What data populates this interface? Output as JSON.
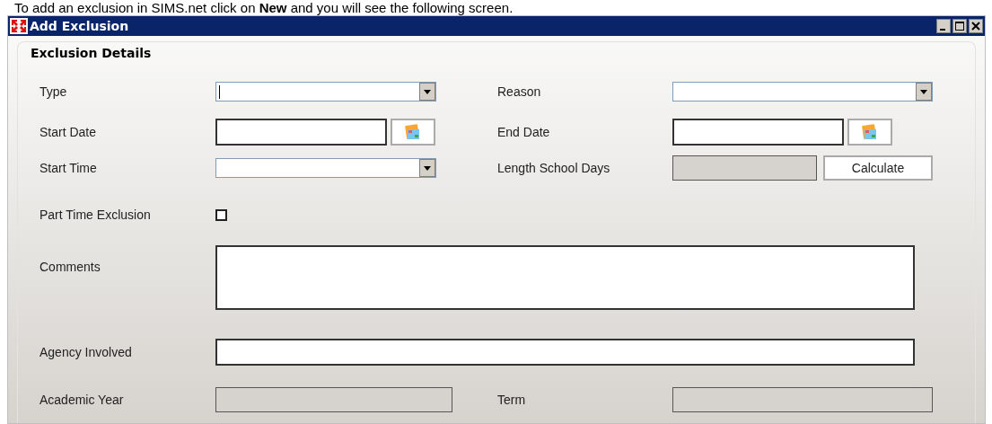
{
  "intro": "To add an exclusion in SIMS.net click on **New** and you will see the following screen.",
  "window": {
    "title": "Add Exclusion"
  },
  "section": {
    "title": "Exclusion Details",
    "rows": [
      {
        "fields": [
          {
            "label": "Type",
            "control": {
              "kind": "dropdown",
              "focused": true
            }
          },
          {
            "label": "Reason",
            "control": {
              "kind": "dropdown",
              "focused": false
            }
          }
        ]
      },
      {
        "fields": [
          {
            "label": "Start Date",
            "control": {
              "kind": "date"
            }
          },
          {
            "label": "End Date",
            "control": {
              "kind": "date"
            }
          }
        ]
      },
      {
        "fields": [
          {
            "label": "Start Time",
            "control": {
              "kind": "dropdown",
              "focused": false
            }
          },
          {
            "label": "Length School Days",
            "control": {
              "kind": "readonly",
              "button": "Calculate"
            }
          }
        ]
      },
      {
        "fields": [
          {
            "label": "Part Time Exclusion",
            "control": {
              "kind": "checkbox",
              "checked": false
            }
          }
        ]
      },
      {
        "fields": [
          {
            "label": "Comments",
            "control": {
              "kind": "textarea"
            }
          }
        ]
      },
      {
        "fields": [
          {
            "label": "Agency Involved",
            "control": {
              "kind": "text"
            }
          }
        ]
      },
      {
        "fields": [
          {
            "label": "Academic Year",
            "control": {
              "kind": "readonly"
            }
          },
          {
            "label": "Term",
            "control": {
              "kind": "readonly"
            }
          }
        ]
      }
    ]
  }
}
